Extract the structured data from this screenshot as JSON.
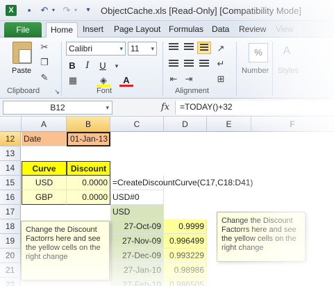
{
  "window": {
    "title": "ObjectCache.xls  [Read-Only]  [Compatibility Mode]"
  },
  "tabs": {
    "file": "File",
    "items": [
      "Home",
      "Insert",
      "Page Layout",
      "Formulas",
      "Data",
      "Review",
      "View"
    ]
  },
  "ribbon": {
    "paste_label": "Paste",
    "font_name": "Calibri",
    "font_size": "11",
    "bold": "B",
    "italic": "I",
    "underline": "U",
    "number_symbol": "%",
    "number_label": "Number",
    "styles_label": "Styles",
    "groups": {
      "clipboard": "Clipboard",
      "font": "Font",
      "alignment": "Alignment"
    }
  },
  "formula_bar": {
    "name_box": "B12",
    "fx": "fx",
    "formula": "=TODAY()+32"
  },
  "columns": [
    "A",
    "B",
    "C",
    "D",
    "E",
    "F"
  ],
  "rows": [
    "12",
    "13",
    "14",
    "15",
    "16",
    "17",
    "18",
    "19",
    "20",
    "21",
    "22"
  ],
  "cells": {
    "a12": "Date",
    "b12": "01-Jan-13",
    "a14": "Curve",
    "b14": "Discount",
    "a15": "USD",
    "b15": "0.0000",
    "c15": "=CreateDiscountCurve(C17,C18:D41)",
    "a16": "GBP",
    "b16": "0.0000",
    "c16": "USD#0",
    "c17": "USD",
    "dates": [
      "27-Oct-09",
      "27-Nov-09",
      "27-Dec-09",
      "27-Jan-10",
      "27-Feb-10"
    ],
    "factors": [
      "0.9999",
      "0.996499",
      "0.993229",
      "0.98986",
      "0.986505"
    ]
  },
  "notes": {
    "left": "Change the Discount Factorrs here and see the yellow cells on the right change",
    "right": "Change the Discount Factorrs here and see the yellow cells on the right change"
  },
  "colors": {
    "peach": "#fac090",
    "yellow": "#ffff00",
    "light_yellow": "#ffffcc",
    "green": "#d7e4bc",
    "file_tab": "#2e8b3e"
  }
}
